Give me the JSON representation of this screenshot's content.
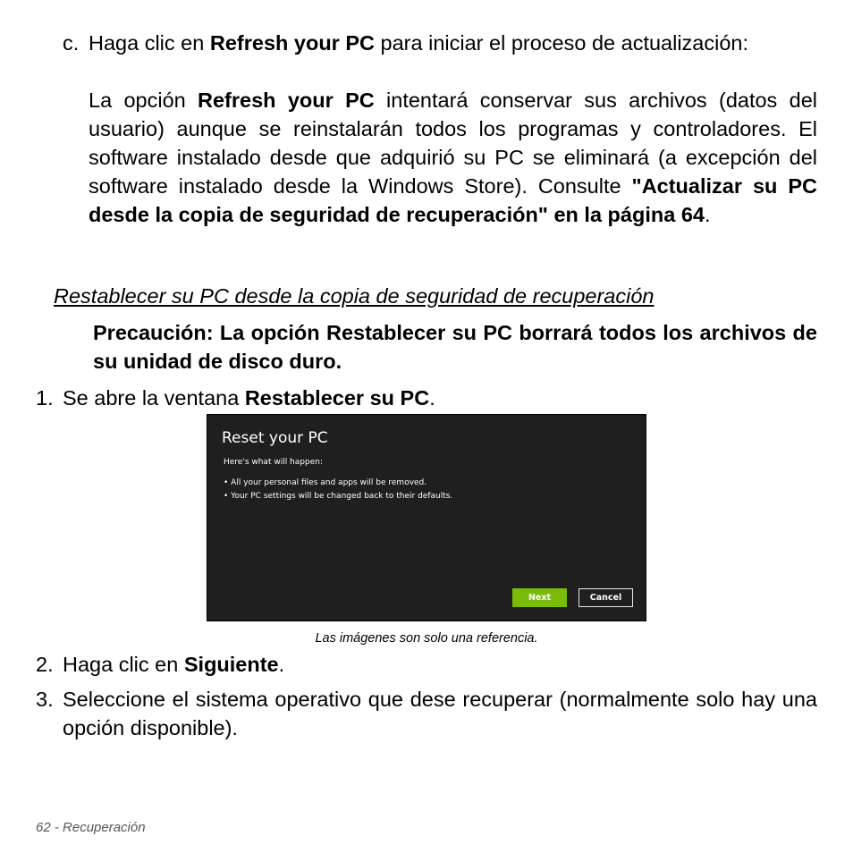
{
  "step_c": {
    "marker": "c.",
    "line1_prefix": "Haga clic en ",
    "line1_bold": "Refresh your PC",
    "line1_suffix": " para iniciar el proceso de actualización:",
    "detail_prefix": "La opción ",
    "detail_bold": "Refresh your PC",
    "detail_text": " intentará conservar sus archivos (datos del usuario) aunque se reinstalarán todos los programas y controladores. El software instalado desde que adquirió su PC se eliminará (a excepción del software instalado desde la Windows Store). Consulte ",
    "detail_link_bold": "\"Actualizar su PC desde la copia de seguridad de recuperación\" en la página 64",
    "detail_end": "."
  },
  "section_heading": "Restablecer su PC desde la copia de seguridad de recuperación",
  "caution": "Precaución: La opción Restablecer su PC borrará todos los archivos de su unidad de disco duro.",
  "steps": [
    {
      "marker": "1.",
      "prefix": "Se abre la ventana ",
      "bold": "Restablecer su PC",
      "suffix": "."
    },
    {
      "marker": "2.",
      "prefix": "Haga clic en ",
      "bold": "Siguiente",
      "suffix": "."
    },
    {
      "marker": "3.",
      "prefix": "Seleccione el sistema operativo que dese recuperar (normalmente solo hay una opción disponible).",
      "bold": "",
      "suffix": ""
    }
  ],
  "screenshot": {
    "title": "Reset your PC",
    "subtitle": "Here's what will happen:",
    "bullets": [
      "• All your personal files and apps will be removed.",
      "• Your PC settings will be changed back to their defaults."
    ],
    "next_label": "Next",
    "cancel_label": "Cancel",
    "colors": {
      "background": "#1f1f1f",
      "accent": "#7bbc0b"
    }
  },
  "caption": "Las imágenes son solo una referencia.",
  "footer": "62 - Recuperación"
}
